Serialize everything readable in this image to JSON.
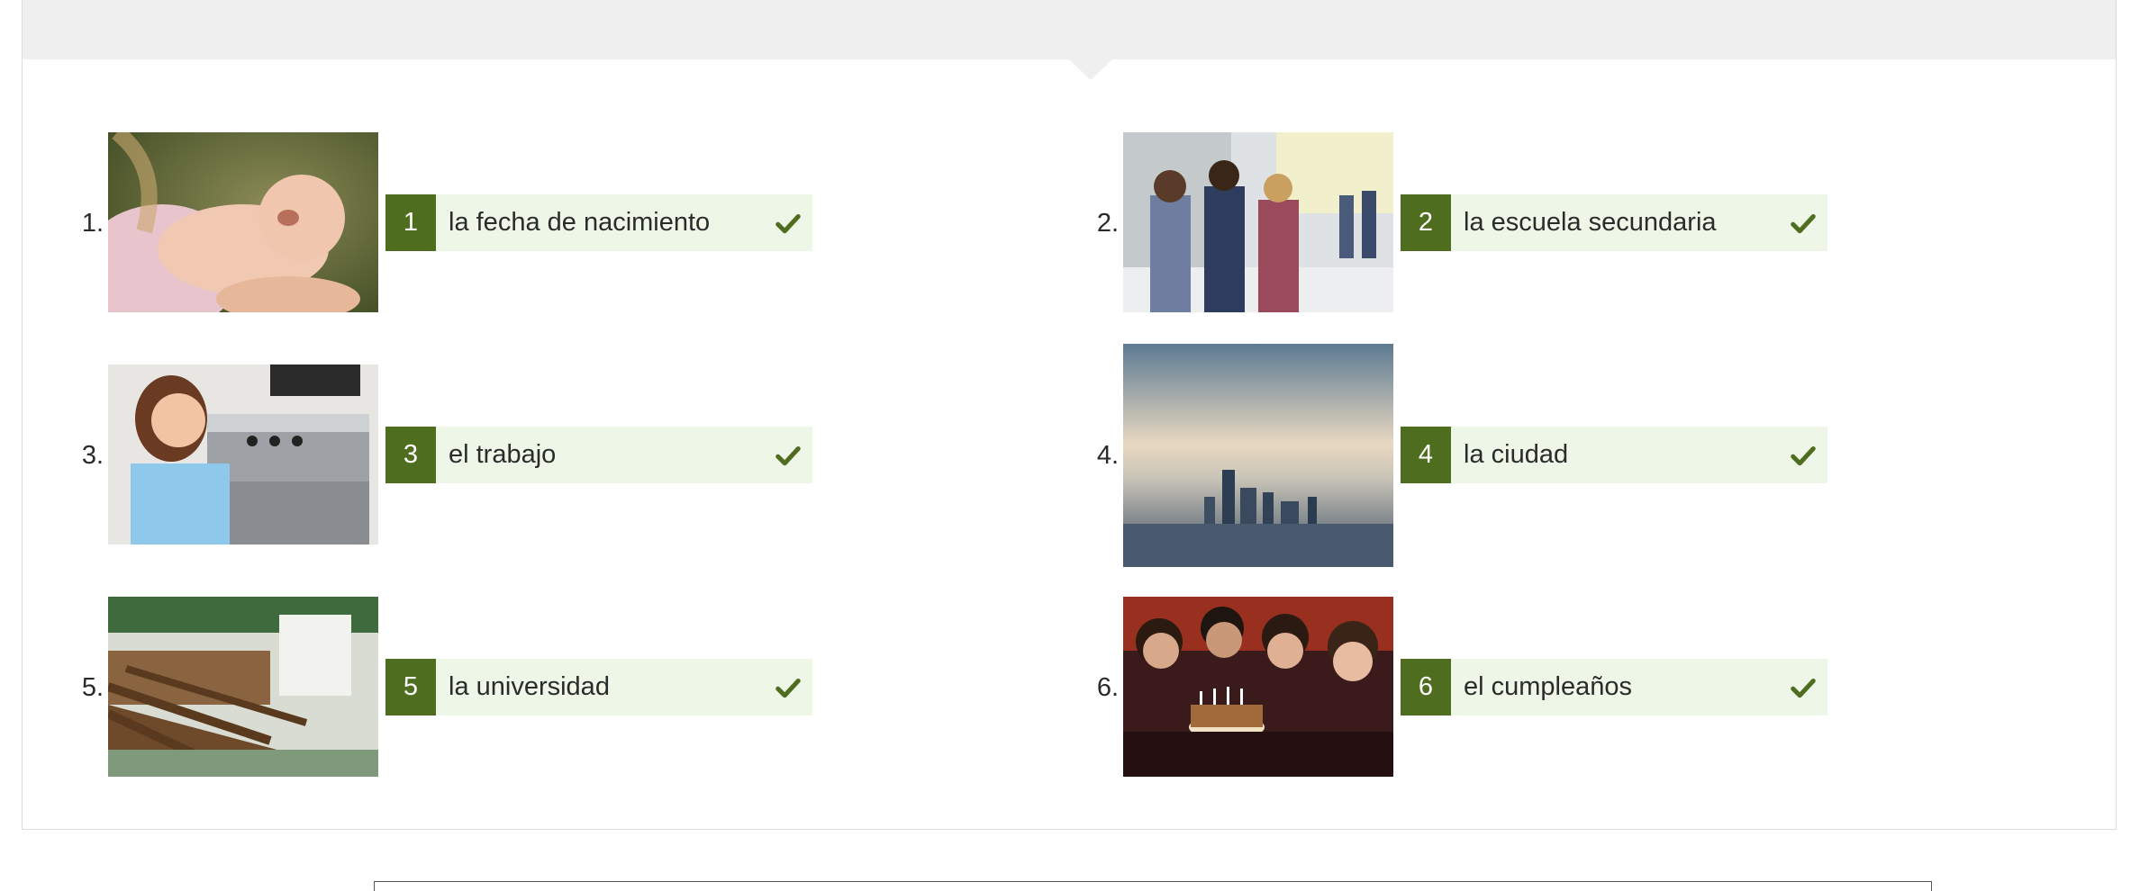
{
  "items": [
    {
      "number": "1.",
      "badge": "1",
      "answer": "la fecha de nacimiento",
      "image_alt": "newborn baby crying"
    },
    {
      "number": "2.",
      "badge": "2",
      "answer": "la escuela secundaria",
      "image_alt": "students talking in school hallway with lockers"
    },
    {
      "number": "3.",
      "badge": "3",
      "answer": "el trabajo",
      "image_alt": "barista at espresso machine"
    },
    {
      "number": "4.",
      "badge": "4",
      "answer": "la ciudad",
      "image_alt": "city skyline at sunset"
    },
    {
      "number": "5.",
      "badge": "5",
      "answer": "la universidad",
      "image_alt": "empty university lecture hall"
    },
    {
      "number": "6.",
      "badge": "6",
      "answer": "el cumpleaños",
      "image_alt": "friends celebrating with birthday cake"
    }
  ],
  "colors": {
    "badge_green": "#4e6d1f",
    "answer_bg": "#eef6e8",
    "check_green": "#4e6d1f",
    "header_gray": "#efefef"
  },
  "icons": {
    "correct": "checkmark-icon"
  }
}
